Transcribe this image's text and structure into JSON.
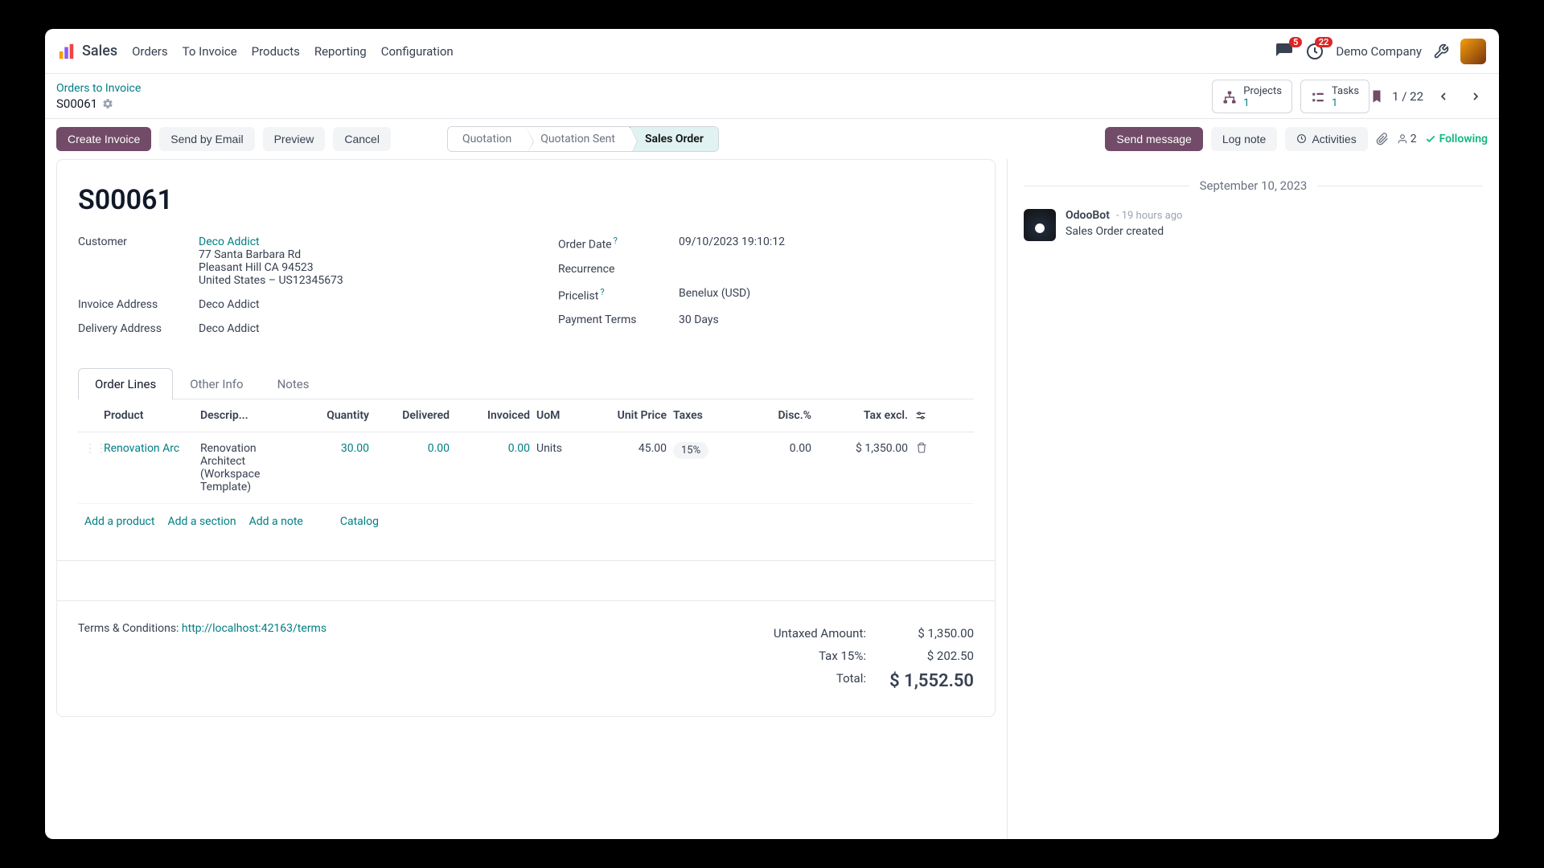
{
  "topbar": {
    "app_name": "Sales",
    "nav": [
      "Orders",
      "To Invoice",
      "Products",
      "Reporting",
      "Configuration"
    ],
    "chat_badge": "5",
    "clock_badge": "22",
    "company": "Demo Company"
  },
  "breadcrumb": {
    "parent": "Orders to Invoice",
    "record": "S00061",
    "stats": [
      {
        "label": "Projects",
        "count": "1"
      },
      {
        "label": "Tasks",
        "count": "1"
      }
    ],
    "pager": "1 / 22"
  },
  "actions": {
    "create_invoice": "Create Invoice",
    "send_email": "Send by Email",
    "preview": "Preview",
    "cancel": "Cancel",
    "status": {
      "q": "Quotation",
      "qs": "Quotation Sent",
      "so": "Sales Order"
    },
    "chatter": {
      "send": "Send message",
      "log": "Log note",
      "activities": "Activities",
      "followers": "2",
      "following": "Following"
    }
  },
  "record": {
    "title": "S00061",
    "left": {
      "customer_label": "Customer",
      "customer_name": "Deco Addict",
      "customer_addr1": "77 Santa Barbara Rd",
      "customer_addr2": "Pleasant Hill CA 94523",
      "customer_addr3": "United States – US12345673",
      "inv_addr_label": "Invoice Address",
      "inv_addr_val": "Deco Addict",
      "del_addr_label": "Delivery Address",
      "del_addr_val": "Deco Addict"
    },
    "right": {
      "order_date_label": "Order Date",
      "order_date_val": "09/10/2023 19:10:12",
      "recurrence_label": "Recurrence",
      "recurrence_val": "",
      "pricelist_label": "Pricelist",
      "pricelist_val": "Benelux (USD)",
      "payterm_label": "Payment Terms",
      "payterm_val": "30 Days"
    },
    "tabs": {
      "lines": "Order Lines",
      "other": "Other Info",
      "notes": "Notes"
    },
    "cols": {
      "product": "Product",
      "desc": "Descrip...",
      "qty": "Quantity",
      "delivered": "Delivered",
      "invoiced": "Invoiced",
      "uom": "UoM",
      "unitprice": "Unit Price",
      "taxes": "Taxes",
      "disc": "Disc.%",
      "taxexcl": "Tax excl."
    },
    "row": {
      "product": "Renovation Arc",
      "desc": "Renovation Architect (Workspace Template)",
      "qty": "30.00",
      "delivered": "0.00",
      "invoiced": "0.00",
      "uom": "Units",
      "unitprice": "45.00",
      "taxes": "15%",
      "disc": "0.00",
      "taxexcl": "$ 1,350.00"
    },
    "footer_links": {
      "add_product": "Add a product",
      "add_section": "Add a section",
      "add_note": "Add a note",
      "catalog": "Catalog"
    },
    "terms": {
      "lbl": "Terms & Conditions: ",
      "url": "http://localhost:42163/terms"
    },
    "totals": {
      "untaxed_lbl": "Untaxed Amount:",
      "untaxed_val": "$ 1,350.00",
      "tax_lbl": "Tax 15%:",
      "tax_val": "$ 202.50",
      "total_lbl": "Total:",
      "total_val": "$ 1,552.50"
    }
  },
  "chatter": {
    "date_sep": "September 10, 2023",
    "msgs": [
      {
        "user": "OdooBot",
        "time": "- 19 hours ago",
        "body": "Sales Order created"
      }
    ]
  }
}
